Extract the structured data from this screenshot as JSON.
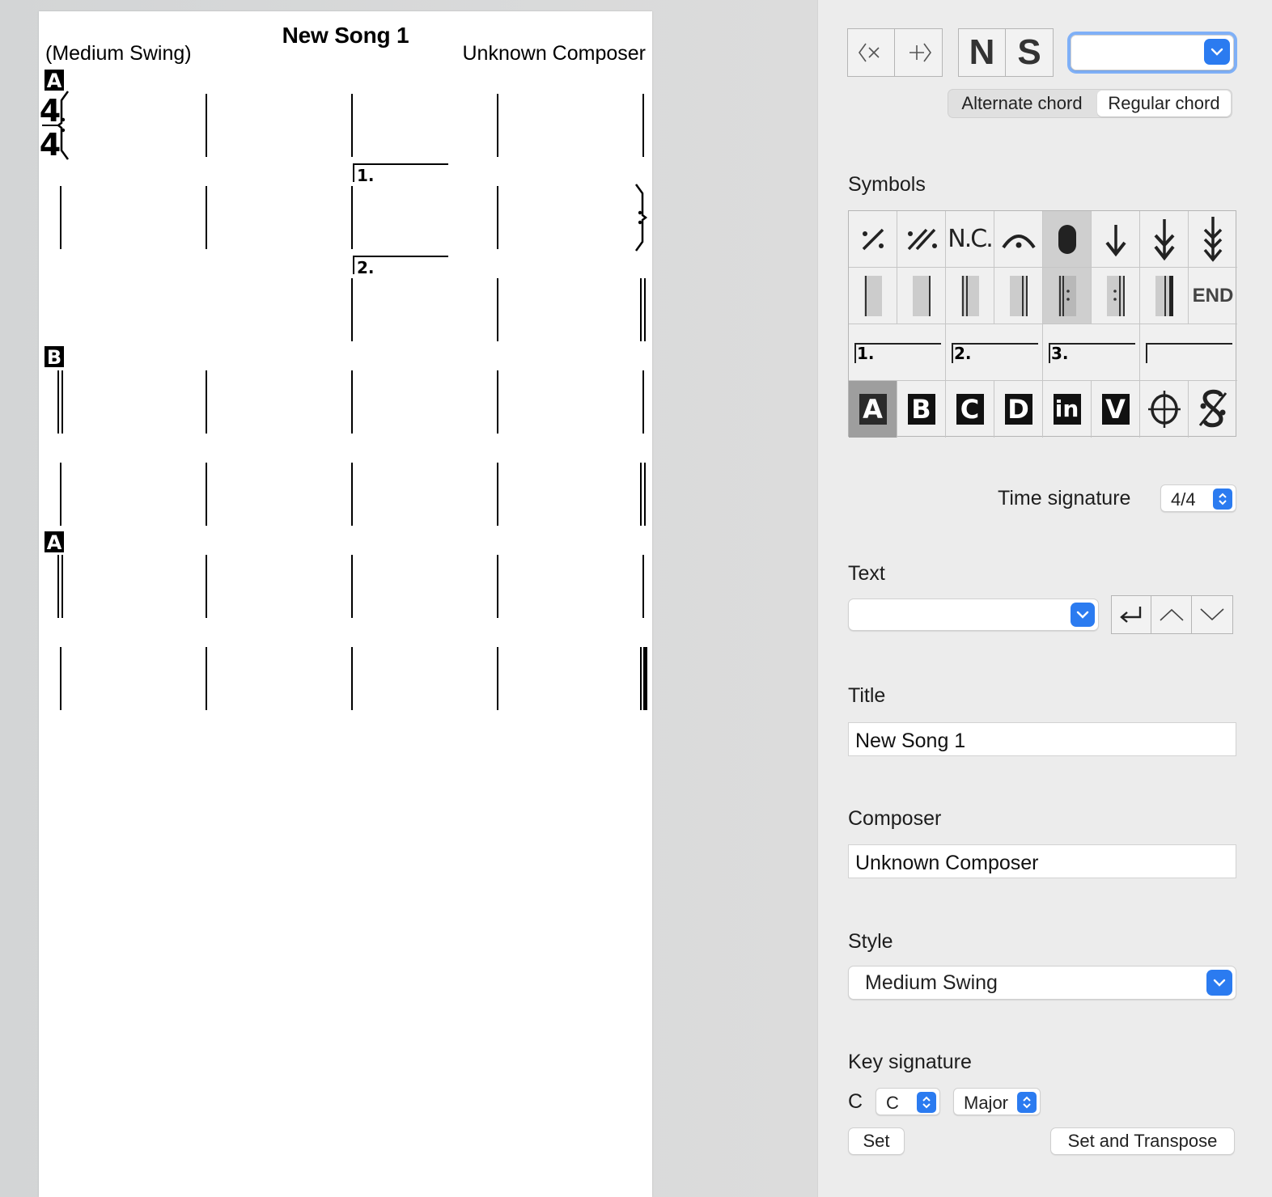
{
  "song": {
    "title": "New Song 1",
    "style_label": "(Medium Swing)",
    "composer": "Unknown Composer",
    "time_signature": {
      "top": "4",
      "bottom": "4"
    },
    "section_marks": [
      "A",
      "B",
      "A"
    ],
    "endings": [
      "1.",
      "2."
    ]
  },
  "toolbar": {
    "nav_prev_icon": "backward-delete-icon",
    "nav_next_icon": "forward-insert-icon",
    "n_label": "N",
    "s_label": "S",
    "chord_combo_value": "",
    "alternate_chord_label": "Alternate chord",
    "regular_chord_label": "Regular chord"
  },
  "symbols": {
    "heading": "Symbols",
    "row1": [
      "repeat-one-bar-icon",
      "repeat-two-bar-icon",
      "N.C.",
      "fermata-icon",
      "whole-rest-icon",
      "down-arrow-icon",
      "double-down-arrow-icon",
      "triple-down-arrow-icon"
    ],
    "row2": [
      "single-barline-icon",
      "thin-barline-icon",
      "double-barline-icon",
      "thin-double-barline-icon",
      "repeat-start-icon",
      "repeat-end-icon",
      "final-barline-icon",
      "END"
    ],
    "row3": [
      "1.",
      "2.",
      "3.",
      ""
    ],
    "row4": [
      "A",
      "B",
      "C",
      "D",
      "in",
      "V",
      "coda-icon",
      "segno-icon"
    ]
  },
  "time_signature": {
    "label": "Time signature",
    "value": "4/4"
  },
  "text": {
    "heading": "Text",
    "combo_value": ""
  },
  "title": {
    "heading": "Title",
    "value": "New Song 1"
  },
  "composer": {
    "heading": "Composer",
    "value": "Unknown Composer"
  },
  "style": {
    "heading": "Style",
    "value": "Medium Swing"
  },
  "key_signature": {
    "heading": "Key signature",
    "current": "C",
    "root_value": "C",
    "mode_value": "Major",
    "set_label": "Set",
    "set_transpose_label": "Set and Transpose"
  },
  "colors": {
    "accent": "#2b7bf0",
    "panel_bg": "#ececec",
    "sheet_bg": "#ffffff"
  }
}
